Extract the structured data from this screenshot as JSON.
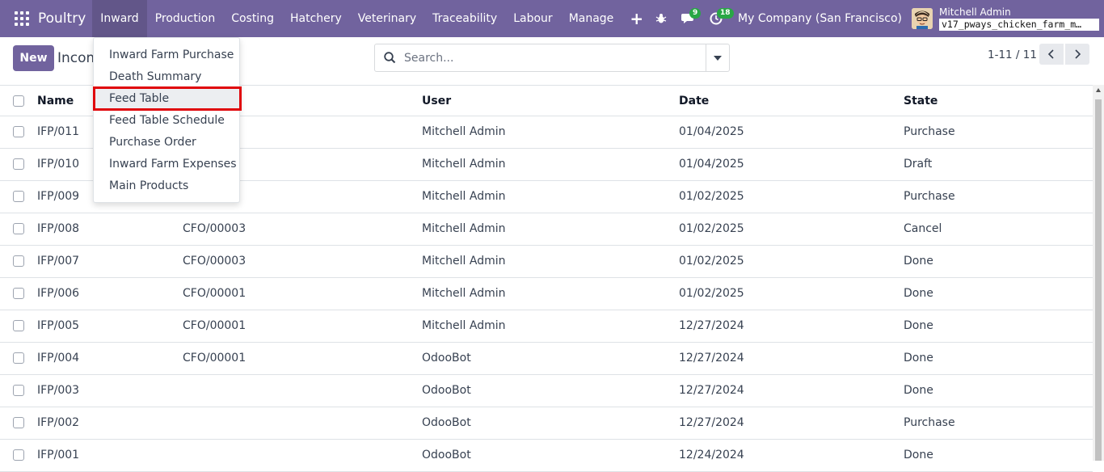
{
  "navbar": {
    "brand": "Poultry",
    "menus": [
      "Inward",
      "Production",
      "Costing",
      "Hatchery",
      "Veterinary",
      "Traceability",
      "Labour",
      "Manage"
    ],
    "active_menu": "Inward",
    "chat_count": "9",
    "activity_count": "18",
    "company": "My Company (San Francisco)",
    "user_name": "Mitchell Admin",
    "db_name": "v17_pways_chicken_farm_m…",
    "accent_color": "#71639e"
  },
  "control_panel": {
    "new_label": "New",
    "breadcrumb": "Incom",
    "search_placeholder": "Search...",
    "pager": "1-11 / 11"
  },
  "inward_menu": {
    "items": [
      "Inward Farm Purchase",
      "Death Summary",
      "Feed Table",
      "Feed Table Schedule",
      "Purchase Order",
      "Inward Farm Expenses",
      "Main Products"
    ],
    "highlighted": "Feed Table"
  },
  "table": {
    "headers": [
      "Name",
      "",
      "User",
      "Date",
      "State"
    ],
    "rows": [
      {
        "name": "IFP/011",
        "ref": "",
        "user": "Mitchell Admin",
        "date": "01/04/2025",
        "state": "Purchase"
      },
      {
        "name": "IFP/010",
        "ref": "",
        "user": "Mitchell Admin",
        "date": "01/04/2025",
        "state": "Draft"
      },
      {
        "name": "IFP/009",
        "ref": "",
        "user": "Mitchell Admin",
        "date": "01/02/2025",
        "state": "Purchase"
      },
      {
        "name": "IFP/008",
        "ref": "CFO/00003",
        "user": "Mitchell Admin",
        "date": "01/02/2025",
        "state": "Cancel"
      },
      {
        "name": "IFP/007",
        "ref": "CFO/00003",
        "user": "Mitchell Admin",
        "date": "01/02/2025",
        "state": "Done"
      },
      {
        "name": "IFP/006",
        "ref": "CFO/00001",
        "user": "Mitchell Admin",
        "date": "01/02/2025",
        "state": "Done"
      },
      {
        "name": "IFP/005",
        "ref": "CFO/00001",
        "user": "Mitchell Admin",
        "date": "12/27/2024",
        "state": "Done"
      },
      {
        "name": "IFP/004",
        "ref": "CFO/00001",
        "user": "OdooBot",
        "date": "12/27/2024",
        "state": "Done"
      },
      {
        "name": "IFP/003",
        "ref": "",
        "user": "OdooBot",
        "date": "12/27/2024",
        "state": "Done"
      },
      {
        "name": "IFP/002",
        "ref": "",
        "user": "OdooBot",
        "date": "12/27/2024",
        "state": "Purchase"
      },
      {
        "name": "IFP/001",
        "ref": "",
        "user": "OdooBot",
        "date": "12/24/2024",
        "state": "Done"
      }
    ]
  }
}
